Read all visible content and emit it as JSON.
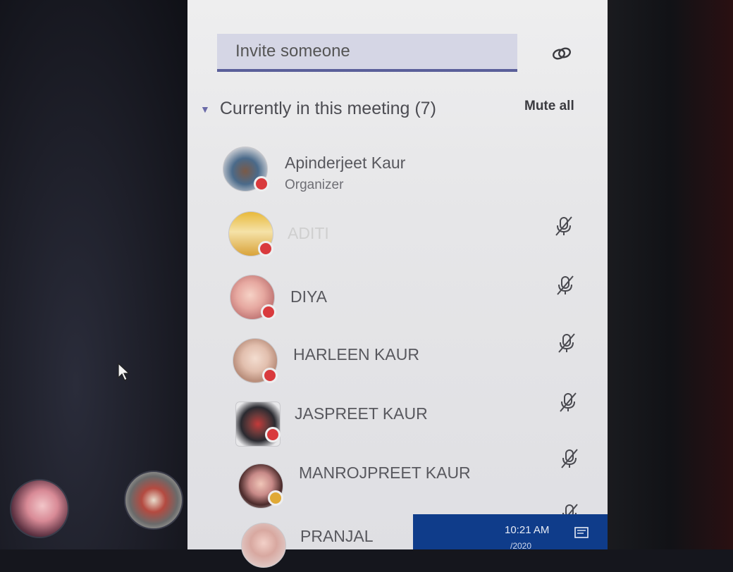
{
  "invite": {
    "placeholder": "Invite someone"
  },
  "participants_section": {
    "heading": "Currently in this meeting (7)",
    "mute_all_label": "Mute all"
  },
  "participants": [
    {
      "name": "Apinderjeet Kaur",
      "role": "Organizer",
      "status": "busy"
    },
    {
      "name": "ADITI",
      "status": "busy",
      "mic": "muted"
    },
    {
      "name": "DIYA",
      "status": "busy",
      "mic": "muted"
    },
    {
      "name": "HARLEEN KAUR",
      "status": "busy",
      "mic": "muted"
    },
    {
      "name": "JASPREET KAUR",
      "status": "busy",
      "mic": "muted"
    },
    {
      "name": "MANROJPREET KAUR",
      "status": "away",
      "mic": "muted"
    },
    {
      "name": "PRANJAL",
      "status": "busy",
      "mic": "muted"
    }
  ],
  "taskbar": {
    "time": "10:21 AM",
    "date": "/2020"
  },
  "colors": {
    "accent": "#5a5f9a",
    "status_busy": "#d93a3d",
    "status_away": "#e0a936"
  },
  "icons": {
    "link": "link-icon",
    "mic": "mic-off-icon",
    "caret": "caret-down-icon",
    "cursor": "mouse-cursor-icon",
    "notification": "notification-icon"
  }
}
